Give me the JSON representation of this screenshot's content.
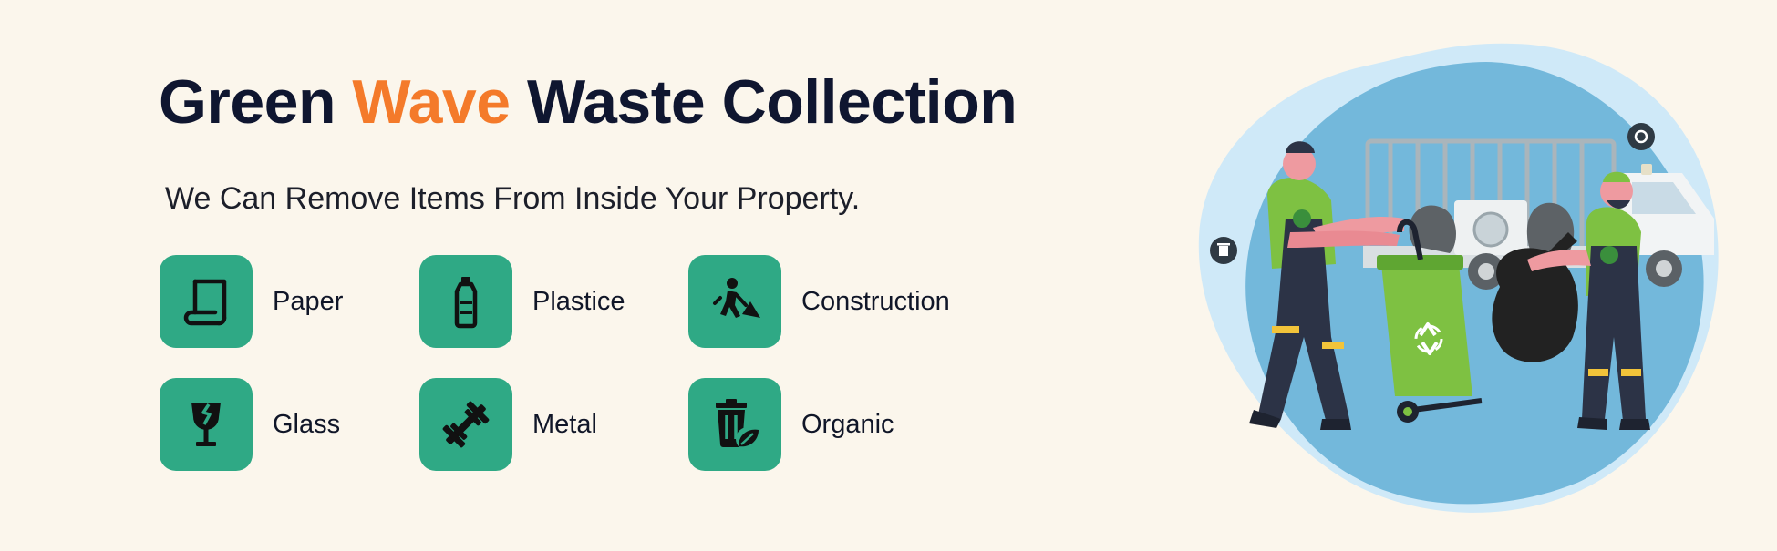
{
  "hero": {
    "title_before": "Green ",
    "title_accent": "Wave",
    "title_after": " Waste Collection",
    "subtitle": "We Can Remove Items From Inside Your Property."
  },
  "categories": [
    {
      "label": "Paper",
      "icon": "paper-scroll-icon"
    },
    {
      "label": "Plastice",
      "icon": "plastic-bottle-icon"
    },
    {
      "label": "Construction",
      "icon": "construction-worker-icon"
    },
    {
      "label": "Glass",
      "icon": "broken-glass-icon"
    },
    {
      "label": "Metal",
      "icon": "dumbbell-icon"
    },
    {
      "label": "Organic",
      "icon": "organic-bin-icon"
    }
  ],
  "illustration": {
    "icons": [
      "trash-badge-icon",
      "recycle-badge-icon",
      "recycle-symbol-icon"
    ]
  },
  "colors": {
    "background": "#fbf6ec",
    "accent": "#f47a2a",
    "tile": "#2fa985",
    "heading": "#0f1630"
  }
}
